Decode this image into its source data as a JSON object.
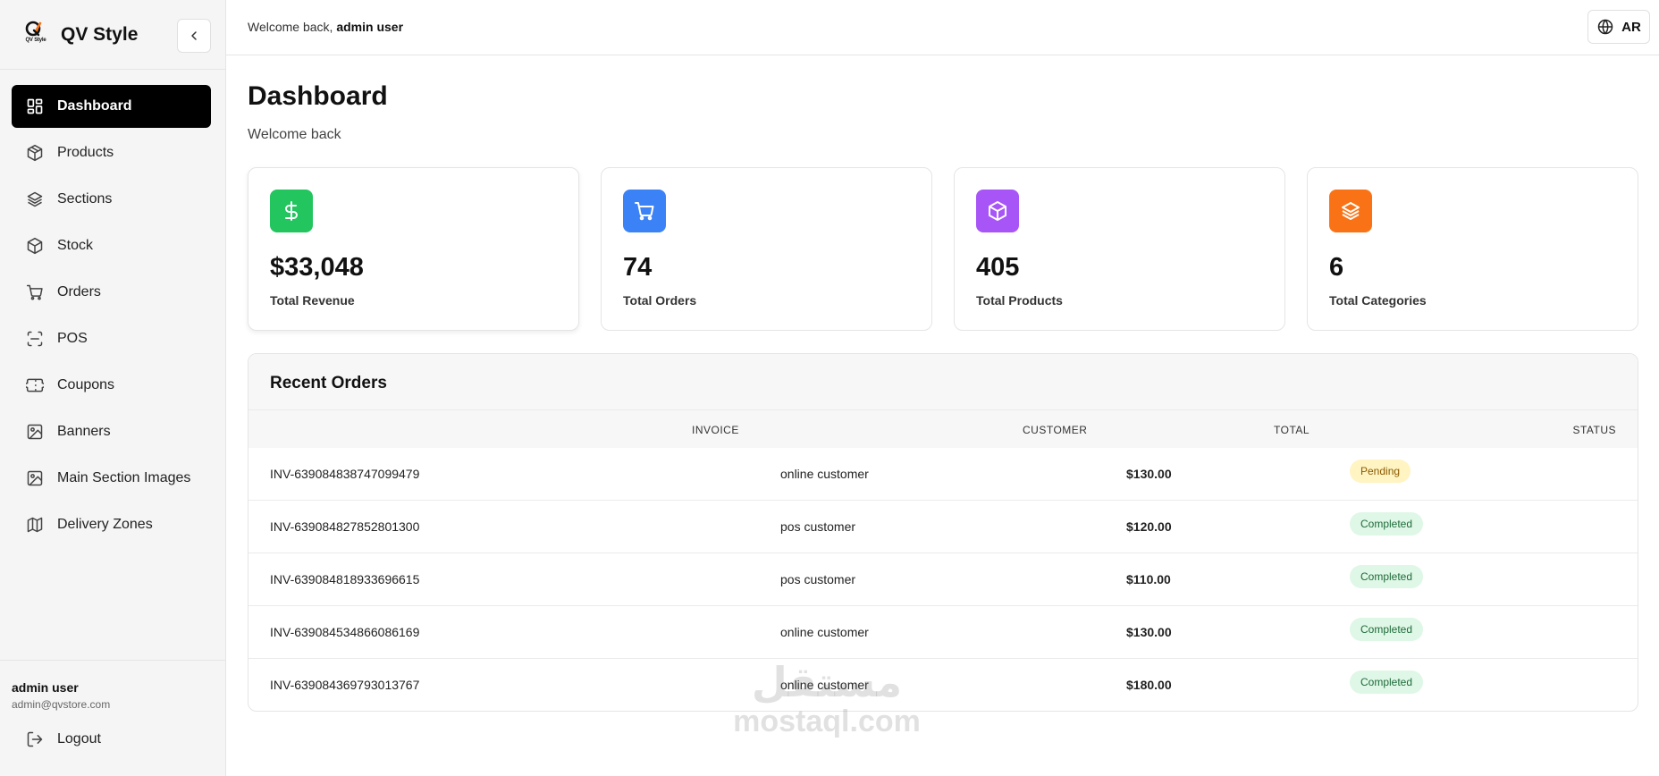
{
  "brand": {
    "title": "QV Style",
    "logo_text": "QV Style"
  },
  "sidebar": {
    "items": [
      {
        "label": "Dashboard",
        "icon": "dashboard-grid-icon",
        "active": true
      },
      {
        "label": "Products",
        "icon": "package-icon"
      },
      {
        "label": "Sections",
        "icon": "layers-icon"
      },
      {
        "label": "Stock",
        "icon": "box-icon"
      },
      {
        "label": "Orders",
        "icon": "cart-icon"
      },
      {
        "label": "POS",
        "icon": "scan-icon"
      },
      {
        "label": "Coupons",
        "icon": "ticket-icon"
      },
      {
        "label": "Banners",
        "icon": "image-icon"
      },
      {
        "label": "Main Section Images",
        "icon": "image-icon"
      },
      {
        "label": "Delivery Zones",
        "icon": "map-icon"
      }
    ],
    "user": {
      "name": "admin user",
      "email": "admin@qvstore.com"
    },
    "logout_label": "Logout"
  },
  "topbar": {
    "welcome_prefix": "Welcome back,",
    "welcome_user": "admin user",
    "lang_label": "AR"
  },
  "page": {
    "title": "Dashboard",
    "subtitle": "Welcome back"
  },
  "stats": [
    {
      "value": "$33,048",
      "label": "Total Revenue",
      "icon": "dollar-icon",
      "color": "#22c55e"
    },
    {
      "value": "74",
      "label": "Total Orders",
      "icon": "cart-icon",
      "color": "#3b82f6"
    },
    {
      "value": "405",
      "label": "Total Products",
      "icon": "package-icon",
      "color": "#a855f7"
    },
    {
      "value": "6",
      "label": "Total Categories",
      "icon": "layers-icon",
      "color": "#f97316"
    }
  ],
  "orders": {
    "title": "Recent Orders",
    "columns": [
      "INVOICE",
      "CUSTOMER",
      "TOTAL",
      "STATUS"
    ],
    "rows": [
      {
        "invoice": "INV-639084838747099479",
        "customer": "online customer",
        "total": "$130.00",
        "status": "Pending"
      },
      {
        "invoice": "INV-639084827852801300",
        "customer": "pos customer",
        "total": "$120.00",
        "status": "Completed"
      },
      {
        "invoice": "INV-639084818933696615",
        "customer": "pos customer",
        "total": "$110.00",
        "status": "Completed"
      },
      {
        "invoice": "INV-639084534866086169",
        "customer": "online customer",
        "total": "$130.00",
        "status": "Completed"
      },
      {
        "invoice": "INV-639084369793013767",
        "customer": "online customer",
        "total": "$180.00",
        "status": "Completed"
      }
    ]
  },
  "watermark": {
    "arabic": "مستقل",
    "latin": "mostaql.com"
  }
}
